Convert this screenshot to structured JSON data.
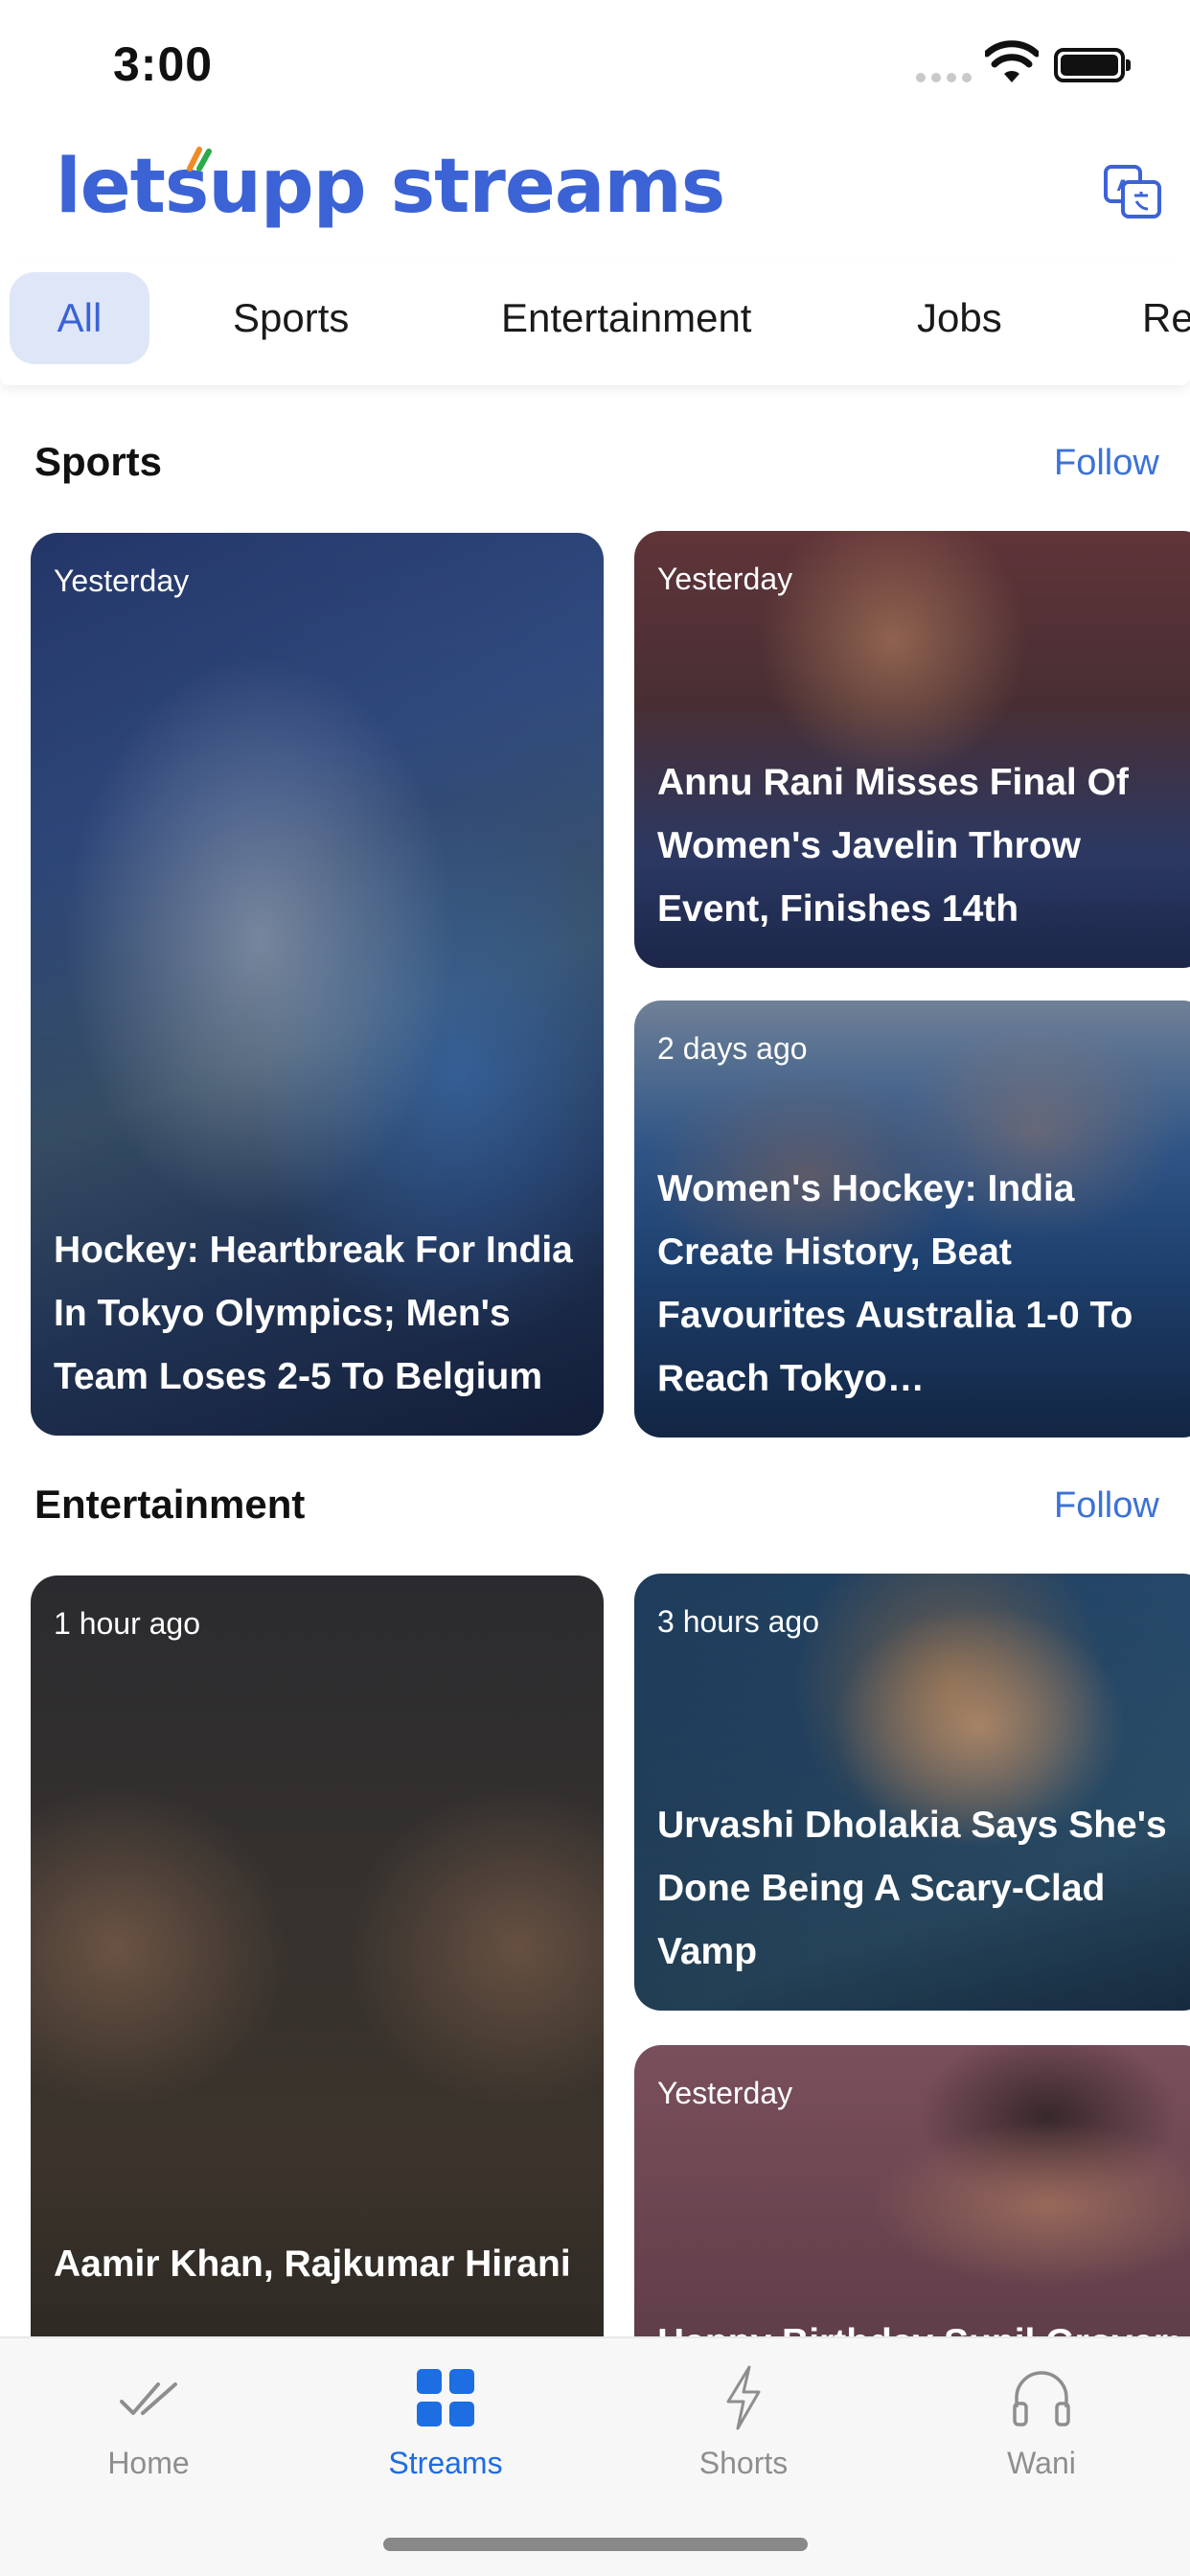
{
  "status": {
    "time": "3:00"
  },
  "header": {
    "logo": "letsupp streams"
  },
  "tabs": [
    {
      "label": "All",
      "active": true
    },
    {
      "label": "Sports"
    },
    {
      "label": "Entertainment"
    },
    {
      "label": "Jobs"
    },
    {
      "label": "Re"
    }
  ],
  "sections": [
    {
      "title": "Sports",
      "follow": "Follow",
      "cards": [
        {
          "time": "Yesterday",
          "headline": "Hockey: Heartbreak For India In Tokyo Olympics; Men's Team Loses 2-5 To Belgium"
        },
        {
          "time": "Yesterday",
          "headline": "Annu Rani Misses Final Of Women's Javelin Throw Event, Finishes 14th"
        },
        {
          "time": "2 days ago",
          "headline": "Women's Hockey: India Create History, Beat Favourites Australia 1-0 To Reach Tokyo…"
        }
      ]
    },
    {
      "title": "Entertainment",
      "follow": "Follow",
      "cards": [
        {
          "time": "1 hour ago",
          "headline": "Aamir Khan, Rajkumar Hirani"
        },
        {
          "time": "3 hours ago",
          "headline": "Urvashi Dholakia Says She's Done Being A Scary-Clad Vamp"
        },
        {
          "time": "Yesterday",
          "headline": "Happy Birthday Sunil Grover:"
        }
      ]
    }
  ],
  "nav": [
    {
      "label": "Home",
      "icon": "double-check-icon"
    },
    {
      "label": "Streams",
      "icon": "grid-icon",
      "active": true
    },
    {
      "label": "Shorts",
      "icon": "lightning-icon"
    },
    {
      "label": "Wani",
      "icon": "headphones-icon"
    }
  ],
  "colors": {
    "brand": "#3c63d6",
    "accent": "#1d6de3",
    "follow": "#3c72d8",
    "tab_active_bg": "#dfe6f8"
  }
}
